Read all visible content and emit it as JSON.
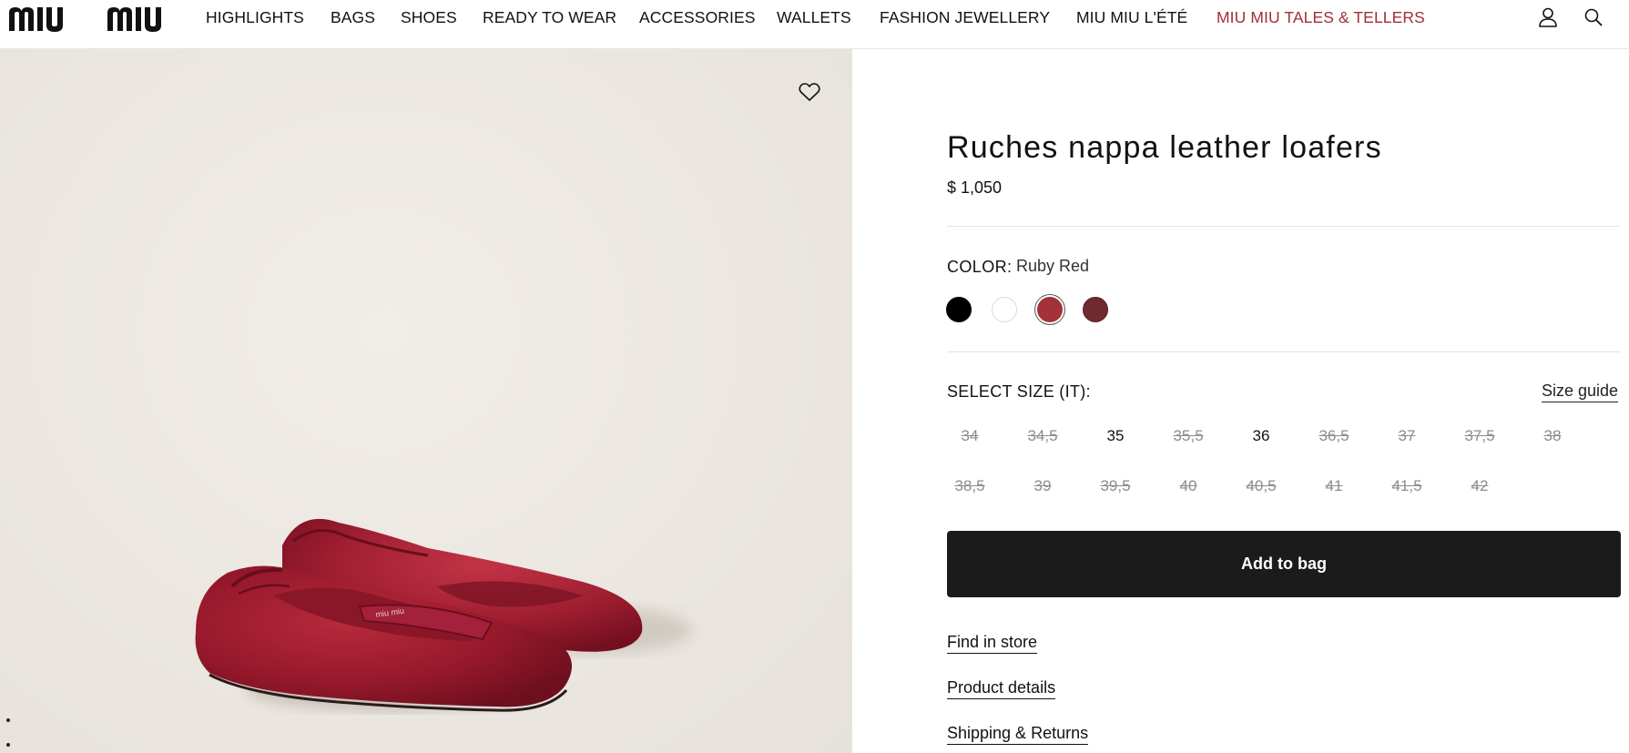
{
  "header": {
    "logo_text": "MIU MIU",
    "nav": [
      {
        "label": "HIGHLIGHTS"
      },
      {
        "label": "BAGS"
      },
      {
        "label": "SHOES"
      },
      {
        "label": "READY TO WEAR"
      },
      {
        "label": "ACCESSORIES"
      },
      {
        "label": "WALLETS"
      },
      {
        "label": "FASHION JEWELLERY"
      },
      {
        "label": "MIU MIU L'ÉTÉ"
      },
      {
        "label": "MIU MIU TALES & TELLERS",
        "accent": true
      }
    ],
    "icons": [
      "account-icon",
      "search-icon"
    ]
  },
  "gallery": {
    "icons": [
      "heart-icon"
    ]
  },
  "product": {
    "title": "Ruches nappa leather loafers",
    "price": "$ 1,050",
    "color_label": "COLOR:",
    "color_value": "Ruby Red",
    "swatches": [
      {
        "name": "black",
        "color": "#000000",
        "selected": false
      },
      {
        "name": "white",
        "color": "#ffffff",
        "selected": false
      },
      {
        "name": "ruby-red",
        "color": "#a3323a",
        "selected": true
      },
      {
        "name": "burgundy",
        "color": "#6e2a2f",
        "selected": false
      }
    ],
    "size_label": "SELECT SIZE (IT):",
    "size_guide": "Size guide",
    "sizes": [
      {
        "label": "34",
        "available": false
      },
      {
        "label": "34,5",
        "available": false
      },
      {
        "label": "35",
        "available": true
      },
      {
        "label": "35,5",
        "available": false
      },
      {
        "label": "36",
        "available": true
      },
      {
        "label": "36,5",
        "available": false
      },
      {
        "label": "37",
        "available": false
      },
      {
        "label": "37,5",
        "available": false
      },
      {
        "label": "38",
        "available": false
      },
      {
        "label": "38,5",
        "available": false
      },
      {
        "label": "39",
        "available": false
      },
      {
        "label": "39,5",
        "available": false
      },
      {
        "label": "40",
        "available": false
      },
      {
        "label": "40,5",
        "available": false
      },
      {
        "label": "41",
        "available": false
      },
      {
        "label": "41,5",
        "available": false
      },
      {
        "label": "42",
        "available": false
      }
    ],
    "add_to_bag": "Add to bag",
    "links": {
      "find_in_store": "Find in store",
      "product_details": "Product details",
      "shipping_returns": "Shipping & Returns"
    }
  },
  "colors": {
    "accent": "#a02f37",
    "button_bg": "#1b1b1b"
  }
}
